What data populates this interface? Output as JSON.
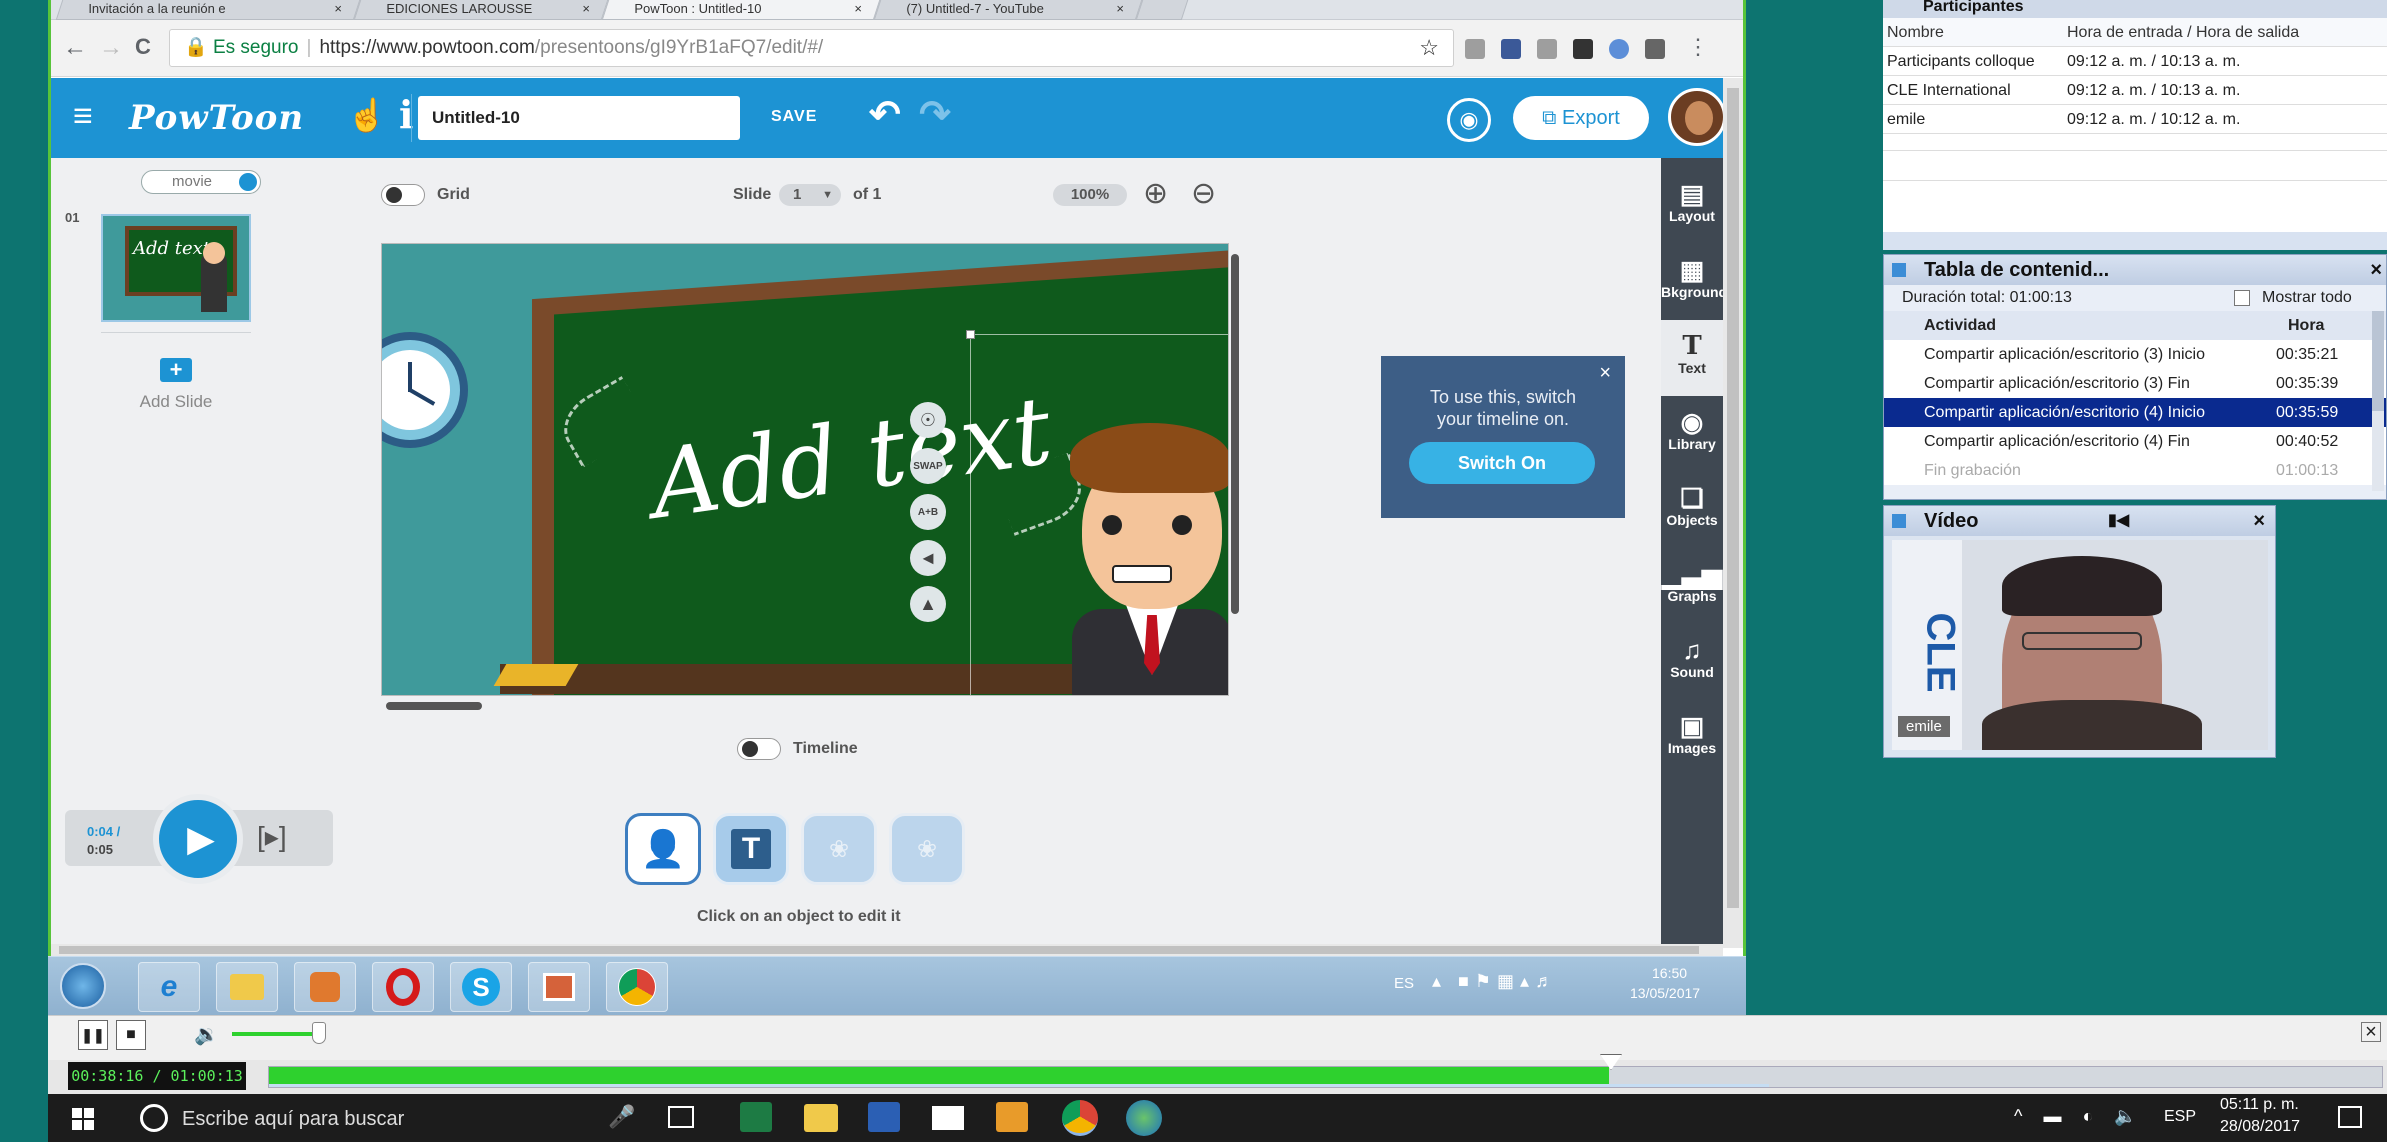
{
  "browser": {
    "tabs": [
      {
        "label": "Invitación a la reunión e",
        "active": false
      },
      {
        "label": "EDICIONES LAROUSSE",
        "active": false
      },
      {
        "label": "PowToon : Untitled-10",
        "active": true
      },
      {
        "label": "(7) Untitled-7 - YouTube",
        "active": false
      }
    ],
    "secure_label": "Es seguro",
    "url_host": "https://www.powtoon.com",
    "url_path": "/presentoons/gI9YrB1aFQ7/edit/#/"
  },
  "powtoon": {
    "logo": "PowToon",
    "title_value": "Untitled-10",
    "save_label": "SAVE",
    "export_label": "Export",
    "mode_toggle_label": "movie",
    "slide_number": "01",
    "add_slide_label": "Add Slide",
    "grid_label": "Grid",
    "slide_label": "Slide",
    "slide_current": "1",
    "slide_of": "of 1",
    "zoom": "100%",
    "stage_text": "Add text",
    "tooltip_text": "To use this, switch your timeline on.",
    "switch_on_label": "Switch On",
    "timeline_label": "Timeline",
    "hint": "Click on an object to edit it",
    "time_current": "0:04 /",
    "time_total": "0:05",
    "right_panel": [
      "Layout",
      "Bkground",
      "Text",
      "Library",
      "Objects",
      "Graphs",
      "Sound",
      "Images"
    ],
    "object_buttons": [
      "character",
      "text",
      "effect",
      "effect"
    ],
    "float_tools": [
      "run",
      "SWAP",
      "A+B",
      "brush",
      "flip"
    ]
  },
  "win7_taskbar": {
    "apps": [
      "start",
      "ie",
      "explorer",
      "media",
      "opera",
      "skype",
      "powerpoint",
      "chrome"
    ],
    "lang": "ES",
    "clock_time": "16:50",
    "clock_date": "13/05/2017"
  },
  "participants": {
    "title": "Participantes",
    "headers": [
      "Nombre",
      "Hora de entrada / Hora de salida"
    ],
    "rows": [
      {
        "name": "Participants colloque",
        "times": "09:12 a. m. / 10:13 a. m."
      },
      {
        "name": "CLE International",
        "times": "09:12 a. m. / 10:13 a. m."
      },
      {
        "name": "emile",
        "times": "09:12 a. m. / 10:12 a. m."
      }
    ]
  },
  "toc": {
    "title": "Tabla de contenid...",
    "total": "Duración total: 01:00:13",
    "show_all": "Mostrar todo",
    "headers": [
      "Actividad",
      "Hora"
    ],
    "rows": [
      {
        "act": "Compartir aplicación/escritorio (3) Inicio",
        "time": "00:35:21",
        "state": "normal"
      },
      {
        "act": "Compartir aplicación/escritorio (3) Fin",
        "time": "00:35:39",
        "state": "normal"
      },
      {
        "act": "Compartir aplicación/escritorio (4) Inicio",
        "time": "00:35:59",
        "state": "selected"
      },
      {
        "act": "Compartir aplicación/escritorio (4) Fin",
        "time": "00:40:52",
        "state": "normal"
      },
      {
        "act": "Fin grabación",
        "time": "01:00:13",
        "state": "disabled"
      }
    ]
  },
  "video": {
    "title": "Vídeo",
    "participant_name": "emile",
    "banner_text": "CLE"
  },
  "player": {
    "time": "00:38:16 / 01:00:13",
    "progress": 0.634
  },
  "win10_taskbar": {
    "search_placeholder": "Escribe aquí para buscar",
    "lang": "ESP",
    "clock_time": "05:11 p. m.",
    "clock_date": "28/08/2017"
  },
  "colors": {
    "powtoon_blue": "#1d93d3",
    "chalkboard": "#0f5a1c",
    "teal_background": "#0d7470",
    "progress_green": "#2ed12e",
    "selected_row": "#0a2a8f"
  }
}
